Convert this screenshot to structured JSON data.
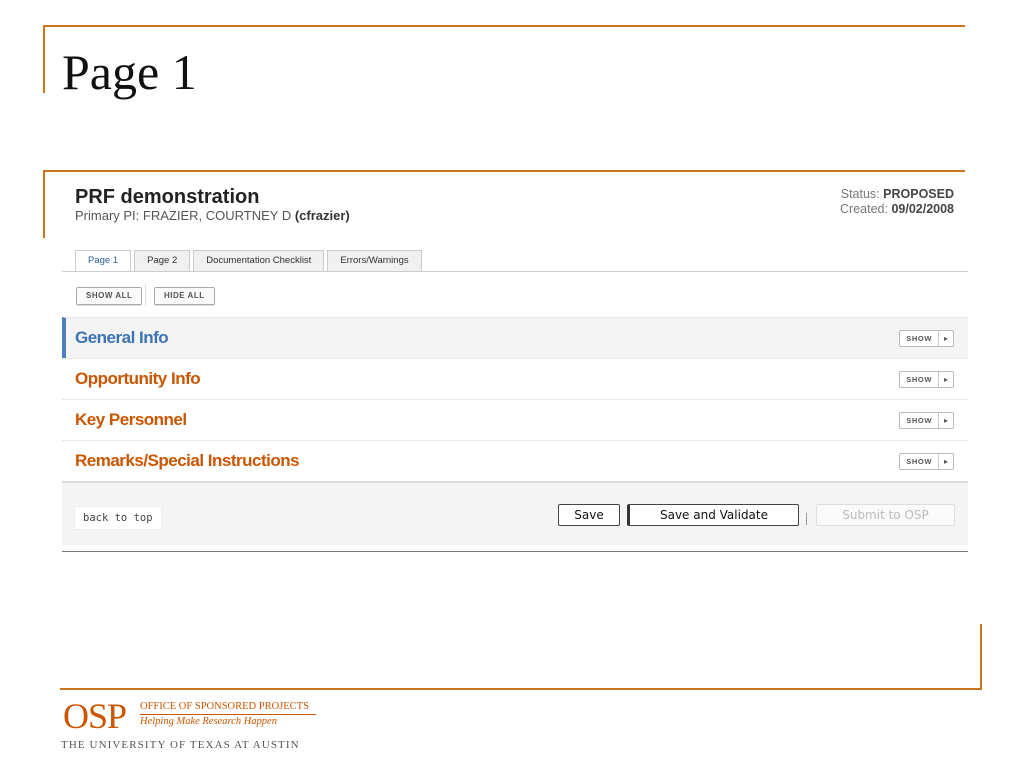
{
  "slide": {
    "title": "Page 1"
  },
  "app": {
    "title": "PRF demonstration",
    "pi_label": "Primary PI: FRAZIER, COURTNEY D",
    "pi_id": "(cfrazier)",
    "status_label": "Status:",
    "status_value": "PROPOSED",
    "created_label": "Created:",
    "created_value": "09/02/2008"
  },
  "tabs": [
    {
      "label": "Page 1",
      "active": true
    },
    {
      "label": "Page 2",
      "active": false
    },
    {
      "label": "Documentation Checklist",
      "active": false
    },
    {
      "label": "Errors/Warnings",
      "active": false
    }
  ],
  "controls": {
    "show_all": "SHOW ALL",
    "hide_all": "HIDE ALL"
  },
  "sections": [
    {
      "title": "General Info",
      "toggle": "SHOW"
    },
    {
      "title": "Opportunity Info",
      "toggle": "SHOW"
    },
    {
      "title": "Key Personnel",
      "toggle": "SHOW"
    },
    {
      "title": "Remarks/Special Instructions",
      "toggle": "SHOW"
    }
  ],
  "actions": {
    "back_to_top": "back to top",
    "save": "Save",
    "save_validate": "Save and Validate",
    "submit": "Submit to OSP"
  },
  "logo": {
    "acronym": "OSP",
    "line1": "OFFICE OF SPONSORED PROJECTS",
    "line2": "Helping Make Research Happen",
    "university": "THE UNIVERSITY OF TEXAS AT AUSTIN"
  },
  "colors": {
    "accent_orange": "#cc5500",
    "accent_blue": "#3c72b6",
    "slide_rule": "#c8751f"
  }
}
